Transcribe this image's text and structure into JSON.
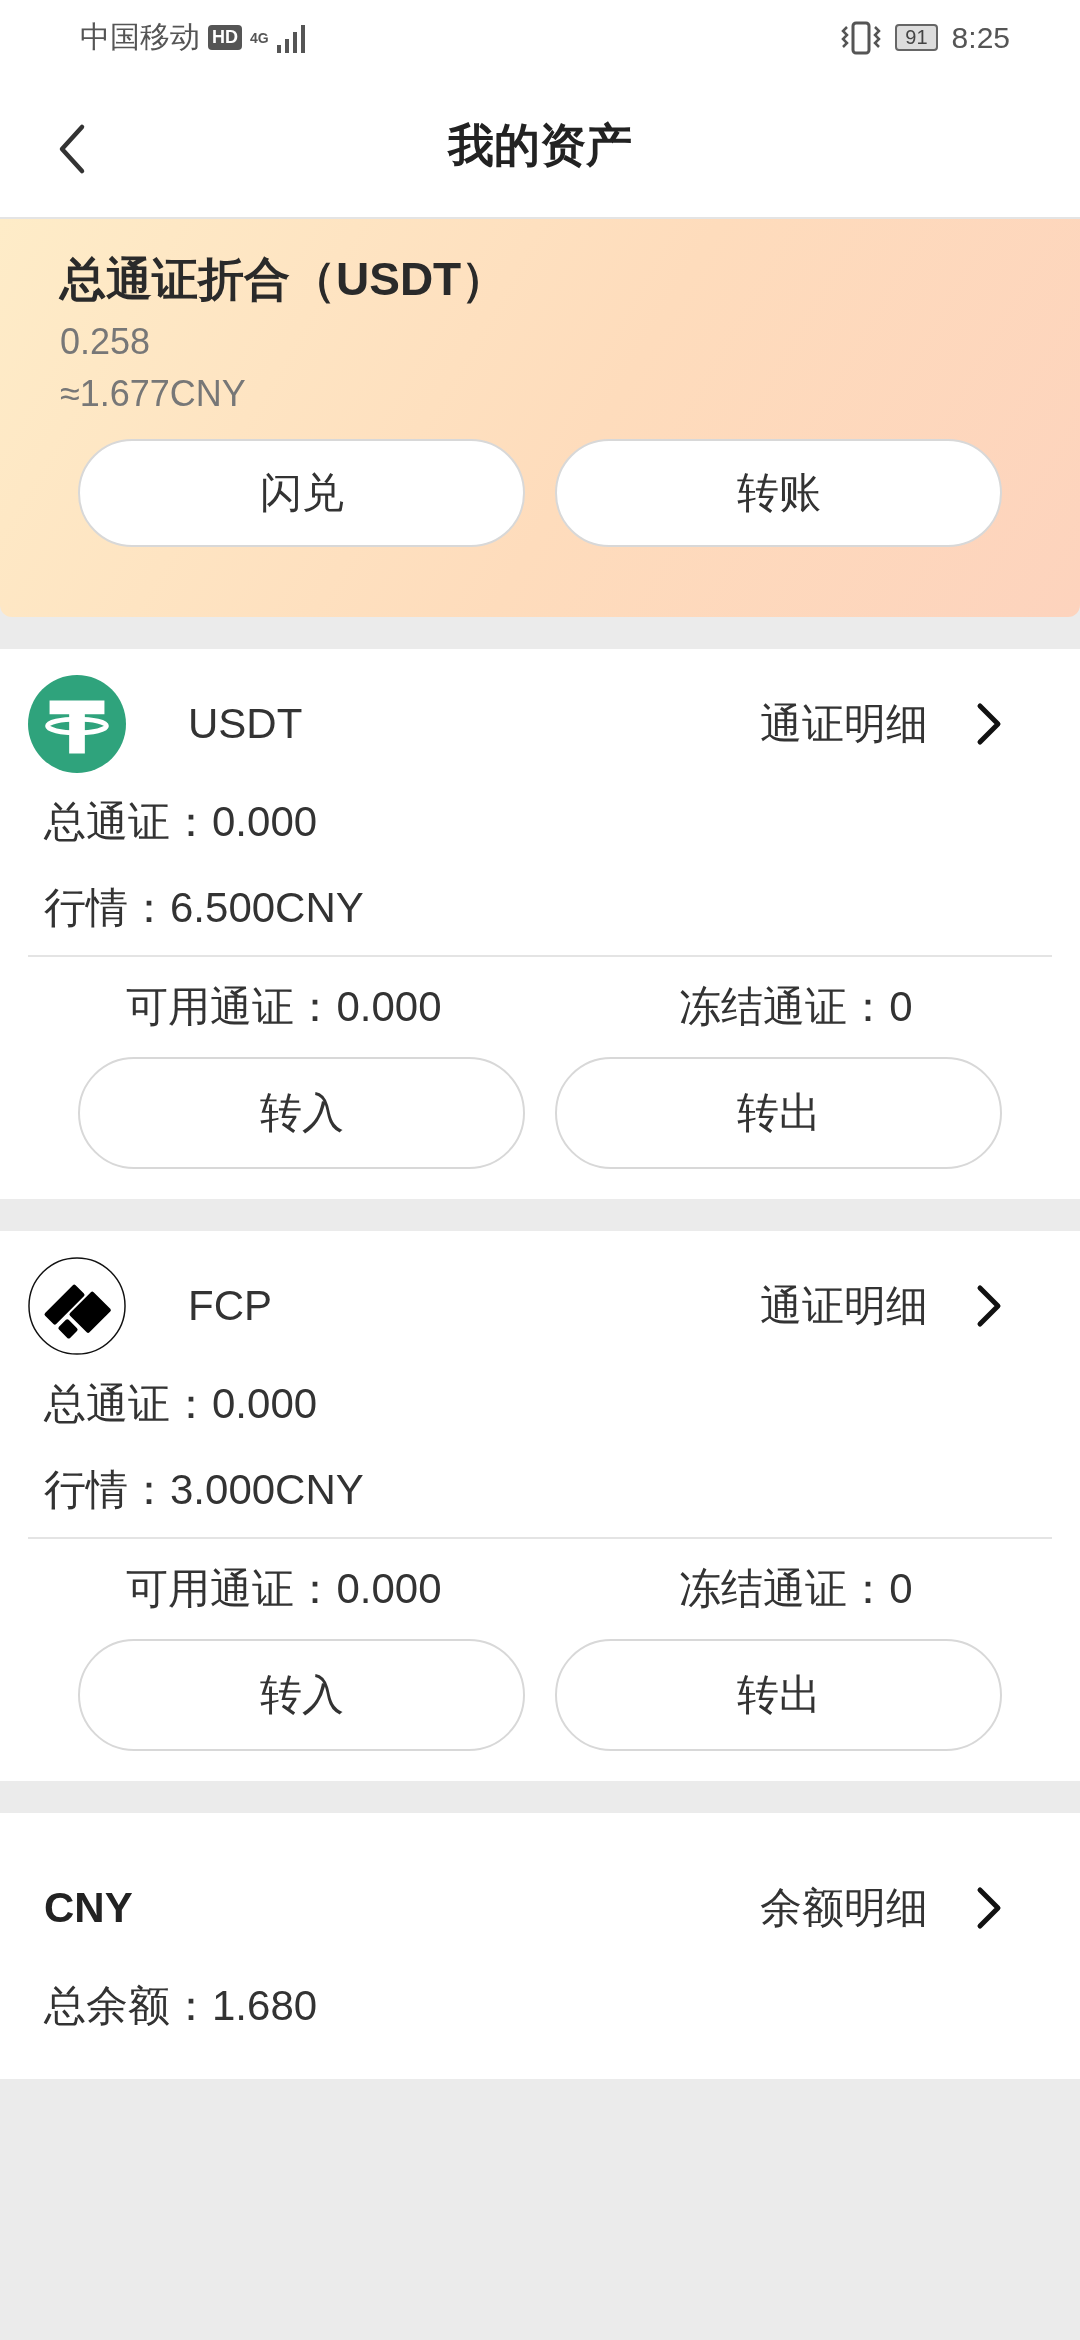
{
  "status_bar": {
    "carrier": "中国移动",
    "hd_badge": "HD",
    "network": "4G",
    "battery": "91",
    "time": "8:25"
  },
  "header": {
    "title": "我的资产"
  },
  "summary": {
    "title": "总通证折合（USDT）",
    "amount": "0.258",
    "approx": "≈1.677CNY",
    "buttons": [
      "闪兑",
      "转账"
    ]
  },
  "assets": [
    {
      "kind": "token",
      "name": "USDT",
      "detail_link": "通证明细",
      "total": "总通证：0.000",
      "price": "行情：6.500CNY",
      "available": "可用通证：0.000",
      "frozen": "冻结通证：0",
      "buttons": [
        "转入",
        "转出"
      ]
    },
    {
      "kind": "token",
      "name": "FCP",
      "detail_link": "通证明细",
      "total": "总通证：0.000",
      "price": "行情：3.000CNY",
      "available": "可用通证：0.000",
      "frozen": "冻结通证：0",
      "buttons": [
        "转入",
        "转出"
      ]
    },
    {
      "kind": "fiat",
      "name": "CNY",
      "detail_link": "余额明细",
      "total": "总余额：1.680"
    }
  ]
}
